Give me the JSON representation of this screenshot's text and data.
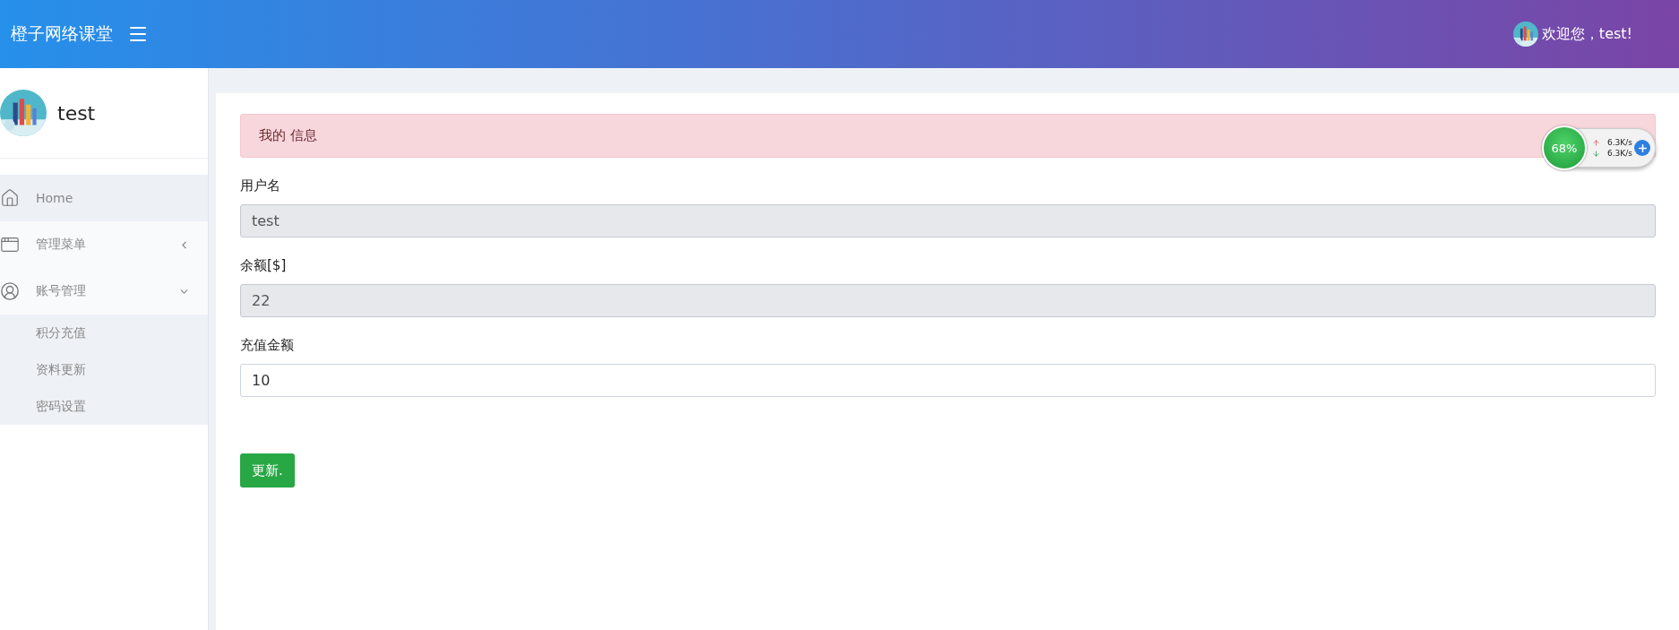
{
  "header": {
    "brand": "橙子网络课堂",
    "welcome": "欢迎您，test!"
  },
  "sidebar": {
    "user": "test",
    "items": [
      {
        "kind": "home",
        "label": "Home"
      },
      {
        "kind": "window",
        "label": "管理菜单",
        "expanded": false
      },
      {
        "kind": "user",
        "label": "账号管理",
        "expanded": true,
        "children": [
          {
            "label": "积分充值"
          },
          {
            "label": "资料更新"
          },
          {
            "label": "密码设置"
          }
        ]
      }
    ]
  },
  "panel": {
    "title": "我的 信息",
    "fields": [
      {
        "label": "用户名",
        "value": "test",
        "disabled": true
      },
      {
        "label": "余额[$]",
        "value": "22",
        "disabled": true
      },
      {
        "label": "充值金额",
        "value": "10",
        "disabled": false
      }
    ],
    "button": "更新."
  },
  "net_widget": {
    "percent": "68%",
    "up": "6.3K/s",
    "down": "6.3K/s"
  }
}
